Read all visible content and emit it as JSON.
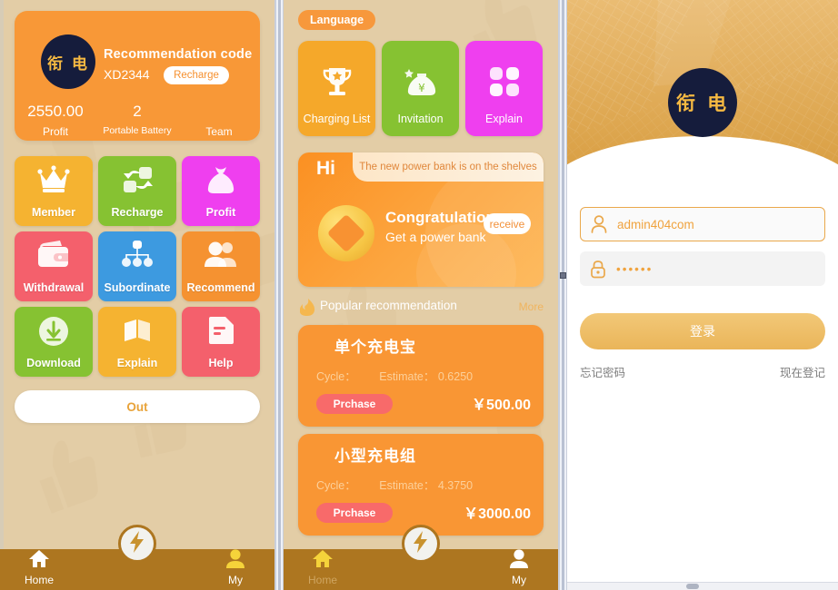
{
  "app": {
    "logo_text": "衔 电",
    "brand_orange": "#f89837",
    "nav_bar_color": "#ad7620"
  },
  "profile_panel": {
    "card": {
      "recommendation_label": "Recommendation code",
      "recommendation_code": "XD2344",
      "recharge_label": "Recharge",
      "stats": [
        {
          "value": "2550.00",
          "label": "Profit"
        },
        {
          "value": "2",
          "label": "Portable Battery"
        },
        {
          "value": "",
          "label": "Team"
        }
      ]
    },
    "tiles": [
      {
        "label": "Member",
        "icon": "crown-icon",
        "color": "#f5b331"
      },
      {
        "label": "Recharge",
        "icon": "exchange-icon",
        "color": "#86c232"
      },
      {
        "label": "Profit",
        "icon": "money-bag-icon",
        "color": "#ef3fef"
      },
      {
        "label": "Withdrawal",
        "icon": "wallet-icon",
        "color": "#f4606c"
      },
      {
        "label": "Subordinate",
        "icon": "hierarchy-icon",
        "color": "#3d9ae0"
      },
      {
        "label": "Recommend",
        "icon": "users-icon",
        "color": "#f59231"
      },
      {
        "label": "Download",
        "icon": "download-icon",
        "color": "#86c232"
      },
      {
        "label": "Explain",
        "icon": "book-icon",
        "color": "#f5b331"
      },
      {
        "label": "Help",
        "icon": "document-icon",
        "color": "#f4606c"
      }
    ],
    "logout_label": "Out",
    "bottom_nav": {
      "home_label": "Home",
      "my_label": "My",
      "active": "my",
      "fab_icon": "lightning-icon"
    }
  },
  "home_panel": {
    "language_label": "Language",
    "categories": [
      {
        "label": "Charging List",
        "icon": "trophy-icon",
        "color": "#f5a82a"
      },
      {
        "label": "Invitation",
        "icon": "money-bag-icon",
        "color": "#86c232"
      },
      {
        "label": "Explain",
        "icon": "grid-icon",
        "color": "#ef3fef"
      }
    ],
    "banner": {
      "hi_label": "Hi",
      "ribbon_text": "The new power bank is on the shelves",
      "title": "Congratulations",
      "subtitle": "Get a power bank",
      "button_label": "receive"
    },
    "popular": {
      "heading": "Popular recommendation",
      "more_label": "More",
      "items": [
        {
          "name": "单个充电宝",
          "cycle_label": "Cycle：",
          "estimate_label": "Estimate：",
          "estimate_value": "0.6250",
          "buy_label": "Prchase",
          "price": "￥500.00"
        },
        {
          "name": "小型充电组",
          "cycle_label": "Cycle：",
          "estimate_label": "Estimate：",
          "estimate_value": "4.3750",
          "buy_label": "Prchase",
          "price": "￥3000.00"
        }
      ]
    },
    "bottom_nav": {
      "home_label": "Home",
      "my_label": "My",
      "active": "home",
      "fab_icon": "lightning-icon"
    }
  },
  "login_panel": {
    "logo_text": "衔 电",
    "username": {
      "value": "admin404com",
      "placeholder": "admin404com",
      "icon": "user-icon"
    },
    "password": {
      "value": "••••••",
      "icon": "lock-icon"
    },
    "submit_label": "登录",
    "forgot_label": "忘记密码",
    "register_label": "现在登记"
  }
}
